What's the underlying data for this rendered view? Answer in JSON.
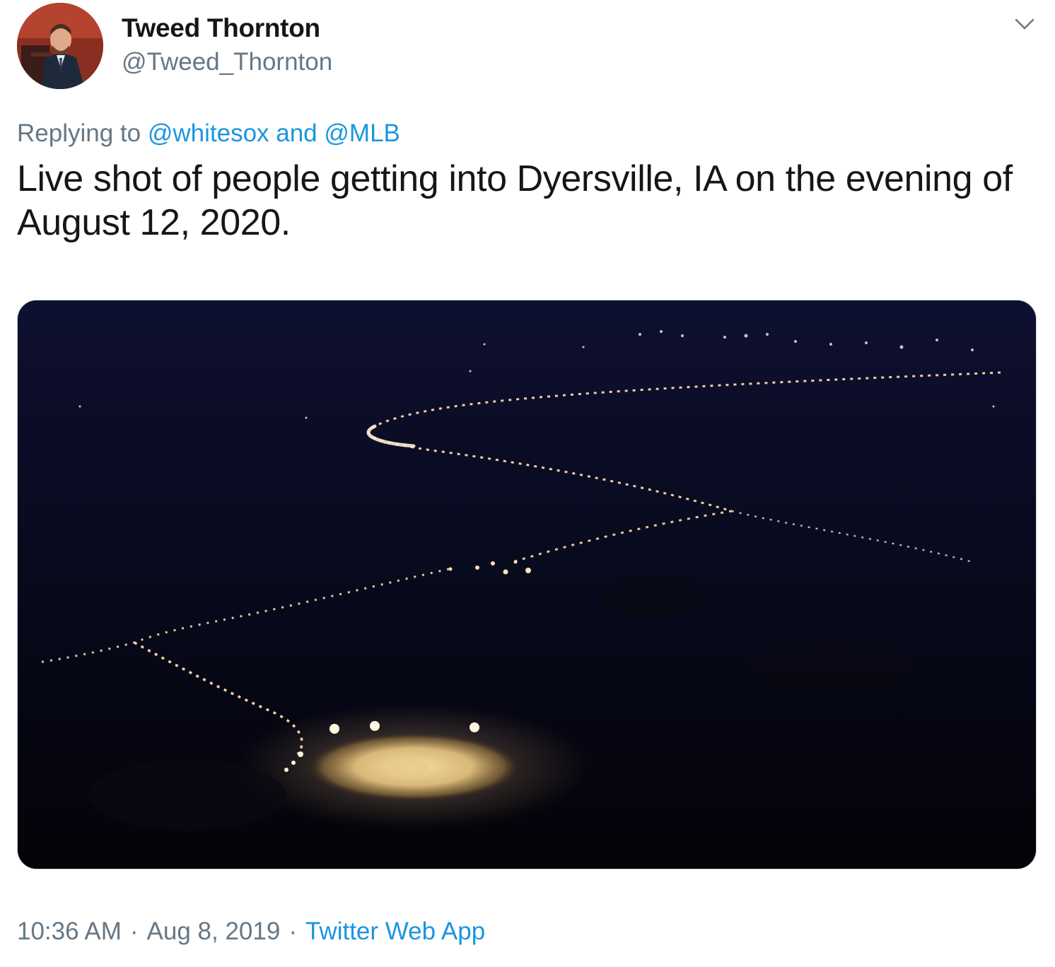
{
  "author": {
    "display_name": "Tweed Thornton",
    "handle": "@Tweed_Thornton"
  },
  "reply": {
    "prefix": "Replying to ",
    "mention_1": "@whitesox",
    "conjunction": " and ",
    "mention_2": "@MLB"
  },
  "tweet": {
    "text": "Live shot of people getting into Dyersville, IA on the evening of August 12, 2020."
  },
  "meta": {
    "time": "10:36 AM",
    "separator": "·",
    "date": "Aug 8, 2019",
    "source": "Twitter Web App"
  },
  "colors": {
    "link": "#1b95e0",
    "secondary_text": "#657786",
    "primary_text": "#14171a"
  },
  "icons": {
    "menu": "chevron-down-icon"
  }
}
